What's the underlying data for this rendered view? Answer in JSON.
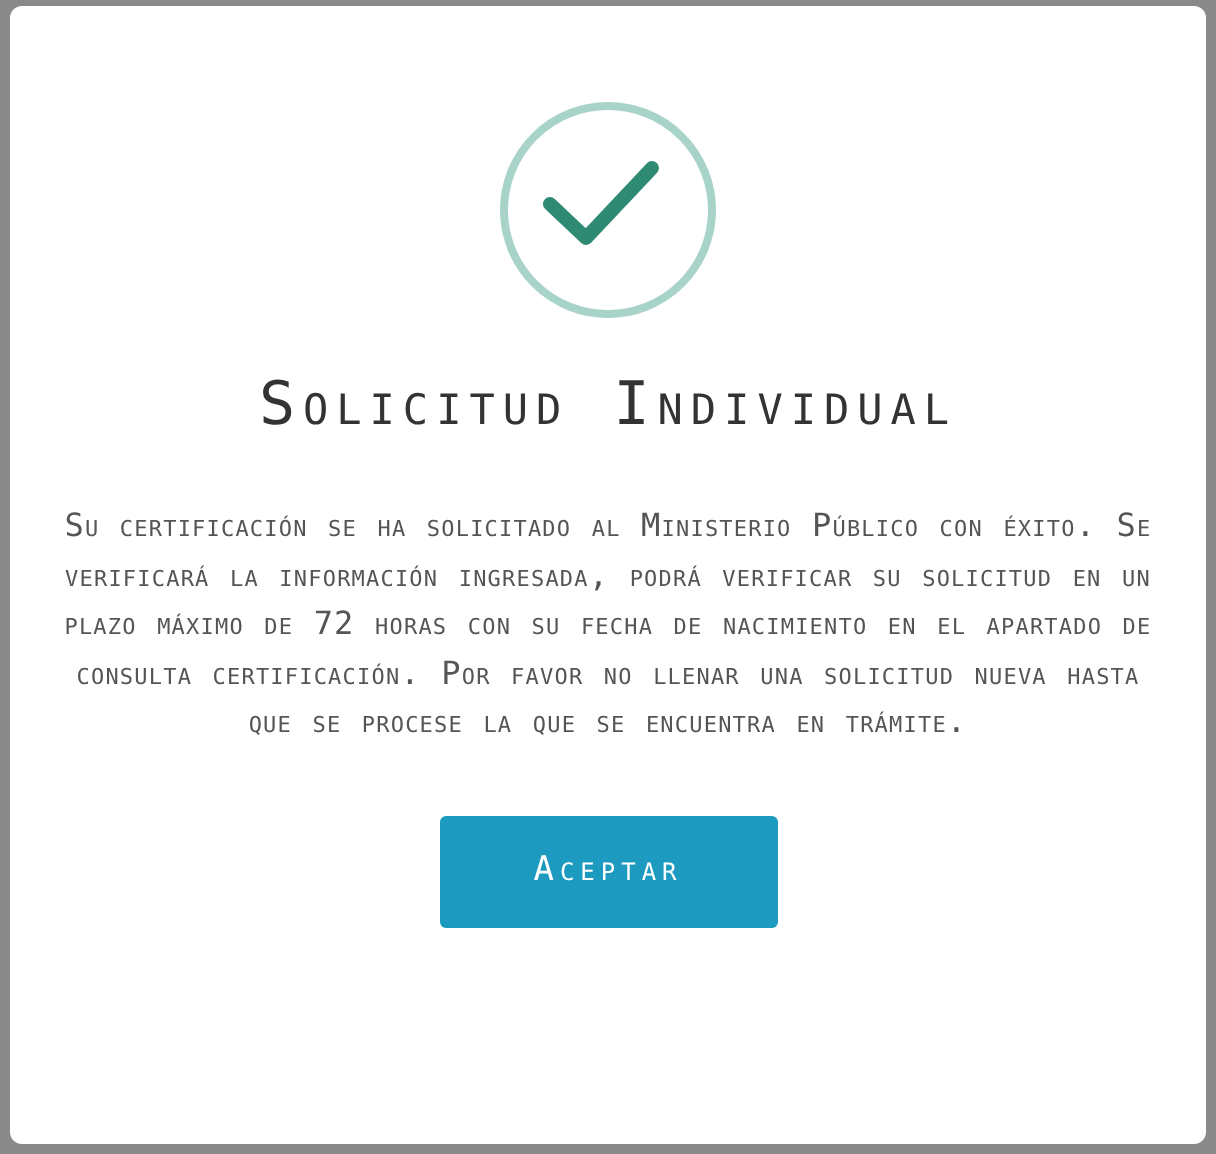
{
  "dialog": {
    "title": "Solicitud Individual",
    "message": "Su certificación se ha solicitado al Ministerio Público con éxito. Se verificará la información ingresada, podrá verificar su solicitud en un plazo máximo de 72 horas con su fecha de nacimiento en el apartado de consulta certificación. Por favor no llenar una solicitud nueva hasta que se procese la que se encuentra en trámite.",
    "buttons": [
      "Aceptar"
    ]
  }
}
